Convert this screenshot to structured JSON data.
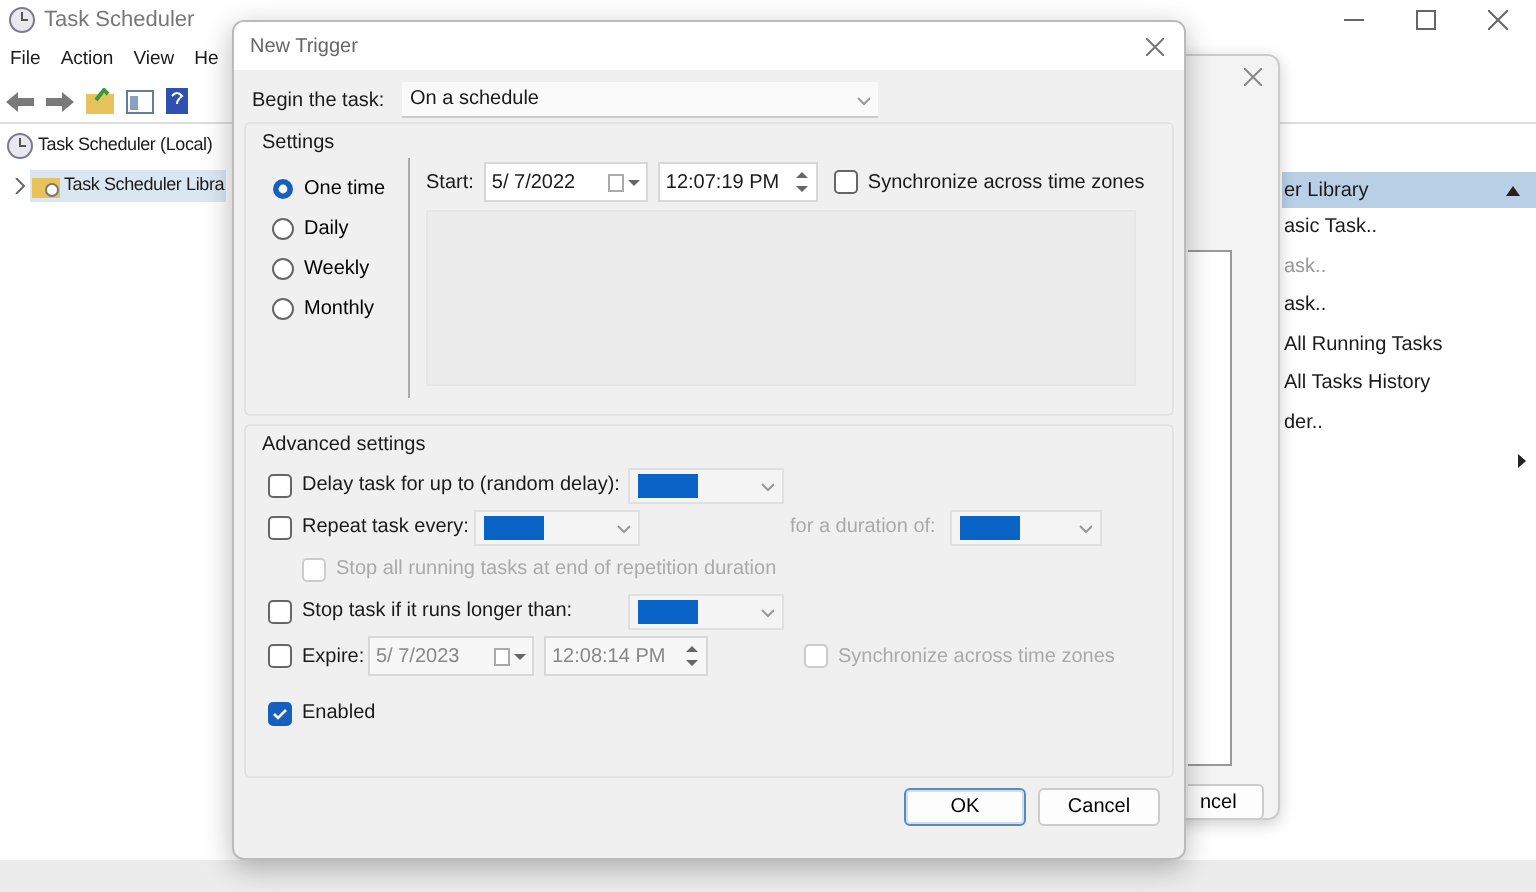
{
  "main_window": {
    "title": "Task Scheduler",
    "menu": [
      "File",
      "Action",
      "View",
      "He"
    ],
    "tree": [
      {
        "label": "Task Scheduler (Local)",
        "selected": false,
        "children": [
          {
            "label": "Task Scheduler Libra",
            "selected": true,
            "expanded": false
          }
        ]
      }
    ],
    "actions": {
      "header": "er Library",
      "expanded": true,
      "items": [
        {
          "kind": "item",
          "label": "asic Task..",
          "disabled": false
        },
        {
          "kind": "item",
          "label": "ask..",
          "disabled": true
        },
        {
          "kind": "item",
          "label": "ask..",
          "disabled": false
        },
        {
          "kind": "item",
          "label": "All Running Tasks",
          "disabled": false
        },
        {
          "kind": "item",
          "label": "All Tasks History",
          "disabled": false
        },
        {
          "kind": "item",
          "label": "der..",
          "disabled": false
        },
        {
          "kind": "submenu"
        }
      ]
    }
  },
  "back_dialog": {
    "button": "ncel"
  },
  "dialog": {
    "title": "New Trigger",
    "begin_label": "Begin the task:",
    "begin_value": "On a schedule",
    "settings": {
      "title": "Settings",
      "schedule": [
        {
          "label": "One time",
          "selected": true
        },
        {
          "label": "Daily",
          "selected": false
        },
        {
          "label": "Weekly",
          "selected": false
        },
        {
          "label": "Monthly",
          "selected": false
        }
      ],
      "start_label": "Start:",
      "start_date": "5/ 7/2022",
      "start_time": "12:07:19 PM",
      "sync": {
        "label": "Synchronize across time zones",
        "checked": false
      }
    },
    "advanced": {
      "title": "Advanced settings",
      "rows": [
        {
          "kind": "combo",
          "label": "Delay task for up to (random delay):",
          "checked": false,
          "disabled": false
        },
        {
          "kind": "repeat",
          "label": "Repeat task every:",
          "checked": false,
          "disabled": false,
          "duration_label": "for a duration of:"
        },
        {
          "kind": "sub",
          "label": "Stop all running tasks at end of repetition duration",
          "checked": false,
          "disabled": true
        },
        {
          "kind": "combo",
          "label": "Stop task if it runs longer than:",
          "checked": false,
          "disabled": false
        },
        {
          "kind": "expire",
          "label": "Expire:",
          "checked": false,
          "disabled": false,
          "date": "5/ 7/2023",
          "time": "12:08:14 PM",
          "sync": {
            "label": "Synchronize across time zones",
            "checked": false,
            "disabled": true
          }
        }
      ]
    },
    "enabled": {
      "label": "Enabled",
      "checked": true
    },
    "buttons": [
      {
        "label": "OK",
        "default": true
      },
      {
        "label": "Cancel",
        "default": false
      }
    ]
  }
}
